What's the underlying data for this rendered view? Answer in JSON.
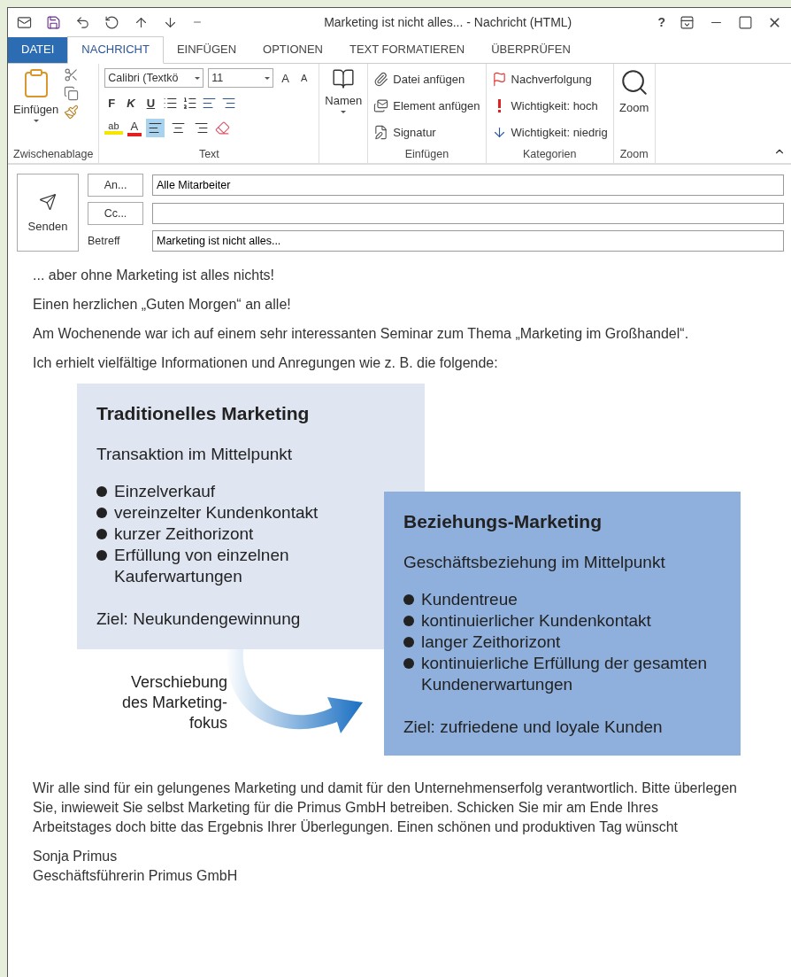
{
  "window": {
    "title": "Marketing ist nicht alles... - Nachricht (HTML)",
    "help": "?"
  },
  "tabs": [
    {
      "label": "DATEI",
      "kind": "file",
      "selected": false
    },
    {
      "label": "NACHRICHT",
      "kind": "tab",
      "selected": true
    },
    {
      "label": "EINFÜGEN",
      "kind": "tab",
      "selected": false
    },
    {
      "label": "OPTIONEN",
      "kind": "tab",
      "selected": false
    },
    {
      "label": "TEXT FORMATIEREN",
      "kind": "tab",
      "selected": false
    },
    {
      "label": "ÜBERPRÜFEN",
      "kind": "tab",
      "selected": false
    }
  ],
  "ribbon": {
    "clipboard": {
      "paste": "Einfügen",
      "group": "Zwischenablage"
    },
    "text": {
      "font": "Calibri (Textkö",
      "size": "11",
      "grow": "A",
      "shrink": "A",
      "bold": "F",
      "italic": "K",
      "underline": "U",
      "highlight": "ab",
      "font_color": "A",
      "alignment": [
        {
          "selected": true
        },
        {
          "selected": false
        },
        {
          "selected": false
        }
      ],
      "group": "Text"
    },
    "names": {
      "label": "Namen"
    },
    "insert": {
      "items": [
        "Datei anfügen",
        "Element anfügen",
        "Signatur"
      ],
      "group": "Einfügen"
    },
    "categories": {
      "items": [
        "Nachverfolgung",
        "Wichtigkeit: hoch",
        "Wichtigkeit: niedrig"
      ],
      "group": "Kategorien"
    },
    "zoom": {
      "label": "Zoom",
      "group": "Zoom"
    }
  },
  "header": {
    "send": "Senden",
    "recipients": [
      {
        "button": "An...",
        "value": "Alle Mitarbeiter"
      },
      {
        "button": "Cc..."
      }
    ],
    "subject": {
      "label": "Betreff",
      "value": "Marketing ist nicht alles..."
    }
  },
  "body": {
    "intro": [
      "... aber ohne Marketing ist alles nichts!",
      "Einen herzlichen „Guten Morgen“ an alle!",
      "Am Wochenende war ich auf einem sehr interessanten Seminar zum Thema „Marketing im Großhandel“.",
      "Ich erhielt vielfältige Informationen und Anregungen wie z. B. die folgende:"
    ],
    "diagram": {
      "left": {
        "title": "Traditionelles Marketing",
        "subtitle": "Transaktion im Mittelpunkt",
        "bullets": [
          "Einzelverkauf",
          "vereinzelter Kundenkontakt",
          "kurzer Zeithorizont",
          "Erfüllung von einzelnen Kauferwartungen"
        ],
        "goal": "Ziel: Neukundengewinnung"
      },
      "right": {
        "title": "Beziehungs-Marketing",
        "subtitle": "Geschäftsbeziehung im Mittelpunkt",
        "bullets": [
          "Kundentreue",
          "kontinuierlicher Kundenkontakt",
          "langer Zeithorizont",
          "kontinuierliche Erfüllung der gesamten Kundenerwartungen"
        ],
        "goal": "Ziel: zufriedene und loyale Kunden"
      },
      "arrow_label": [
        "Verschiebung",
        "des Marketing-",
        "fokus"
      ]
    },
    "closing": "Wir alle sind für ein gelungenes Marketing und damit für den Unternehmenserfolg verantwortlich. Bitte überlegen Sie, inwieweit Sie selbst Marketing für die Primus GmbH betreiben. Schicken Sie mir am Ende Ihres Arbeitstages doch bitte das Ergebnis Ihrer Überlegungen. Einen schönen und produktiven Tag wünscht",
    "signature": [
      "Sonja Primus",
      "Geschäftsführerin Primus GmbH"
    ]
  }
}
